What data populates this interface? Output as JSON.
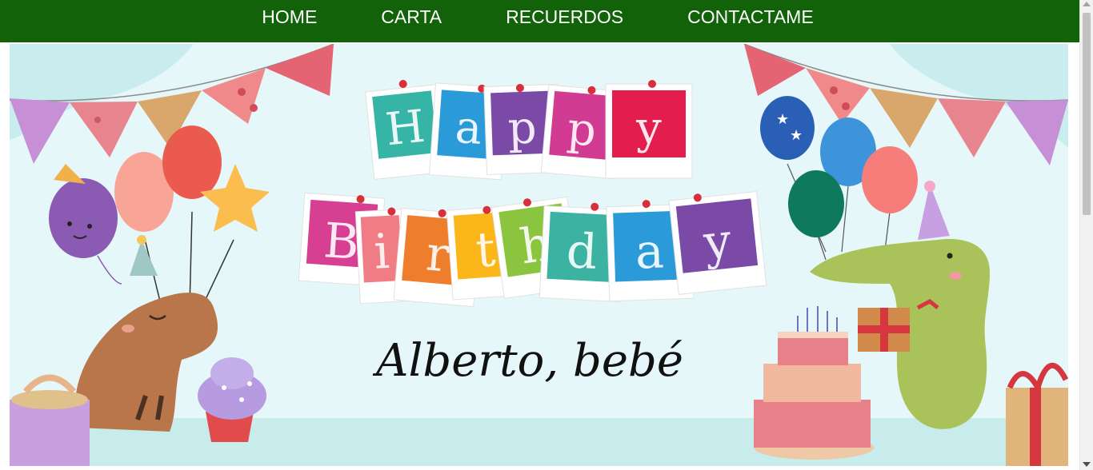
{
  "nav": {
    "items": [
      {
        "label": "HOME"
      },
      {
        "label": "CARTA"
      },
      {
        "label": "RECUERDOS"
      },
      {
        "label": "CONTACTAME"
      }
    ]
  },
  "banner": {
    "happy_letters": [
      "H",
      "a",
      "p",
      "p",
      "y"
    ],
    "birthday_letters": [
      "B",
      "i",
      "r",
      "t",
      "h",
      "d",
      "a",
      "y"
    ],
    "name_text": "Alberto, bebé"
  },
  "colors": {
    "navbar": "#116209",
    "banner_bg": "#e6f7f9",
    "floor": "#c8ecec"
  }
}
